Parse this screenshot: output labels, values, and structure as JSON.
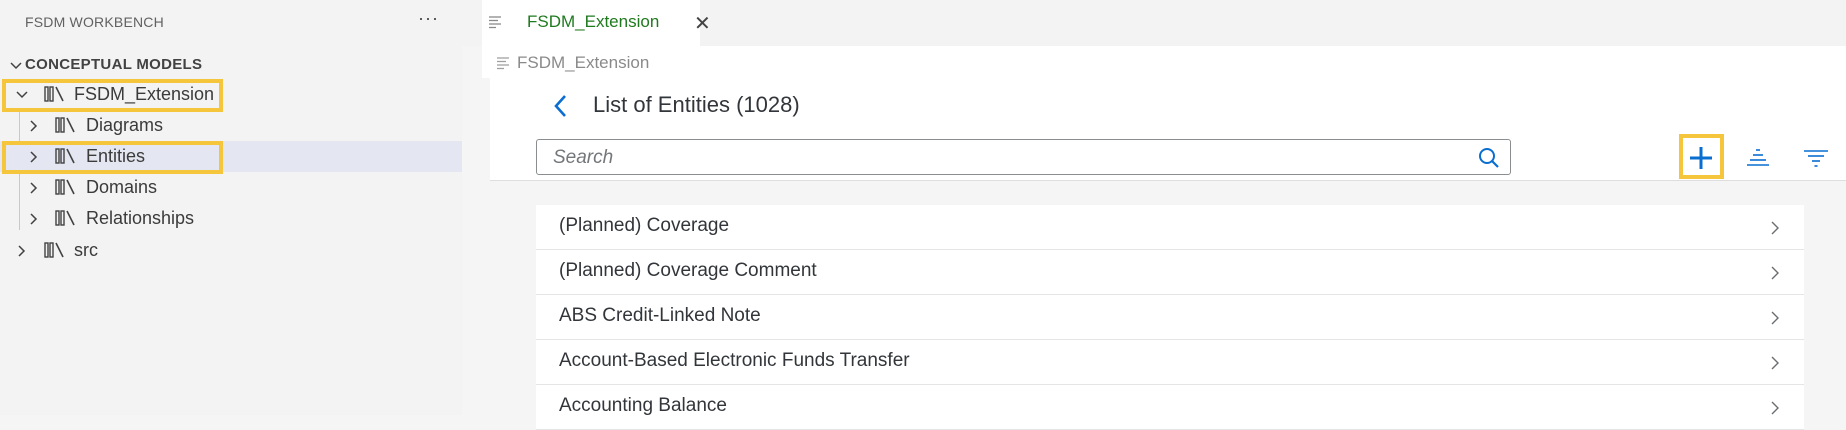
{
  "sidebar": {
    "title": "FSDM WORKBENCH",
    "more_label": "···",
    "section_title": "CONCEPTUAL MODELS",
    "tree": [
      {
        "label": "FSDM_Extension"
      },
      {
        "label": "Diagrams"
      },
      {
        "label": "Entities"
      },
      {
        "label": "Domains"
      },
      {
        "label": "Relationships"
      },
      {
        "label": "src"
      }
    ]
  },
  "editor": {
    "tab": {
      "label": "FSDM_Extension",
      "close": "✕"
    },
    "breadcrumb": "FSDM_Extension",
    "page_title": "List of Entities (1028)",
    "search": {
      "placeholder": "Search",
      "value": ""
    },
    "items": [
      {
        "label": "(Planned) Coverage"
      },
      {
        "label": "(Planned) Coverage Comment"
      },
      {
        "label": "ABS Credit-Linked Note"
      },
      {
        "label": "Account-Based Electronic Funds Transfer"
      },
      {
        "label": "Accounting Balance"
      }
    ]
  },
  "colors": {
    "accent_blue": "#0a6ed1",
    "highlight": "#f5c63c",
    "tab_green": "#1f7a1f",
    "selected_row": "#e4e6f1"
  },
  "icons": [
    "chevron-down-icon",
    "chevron-right-icon",
    "library-icon",
    "file-icon",
    "close-icon",
    "back-icon",
    "search-icon",
    "add-icon",
    "sort-icon",
    "filter-icon"
  ]
}
